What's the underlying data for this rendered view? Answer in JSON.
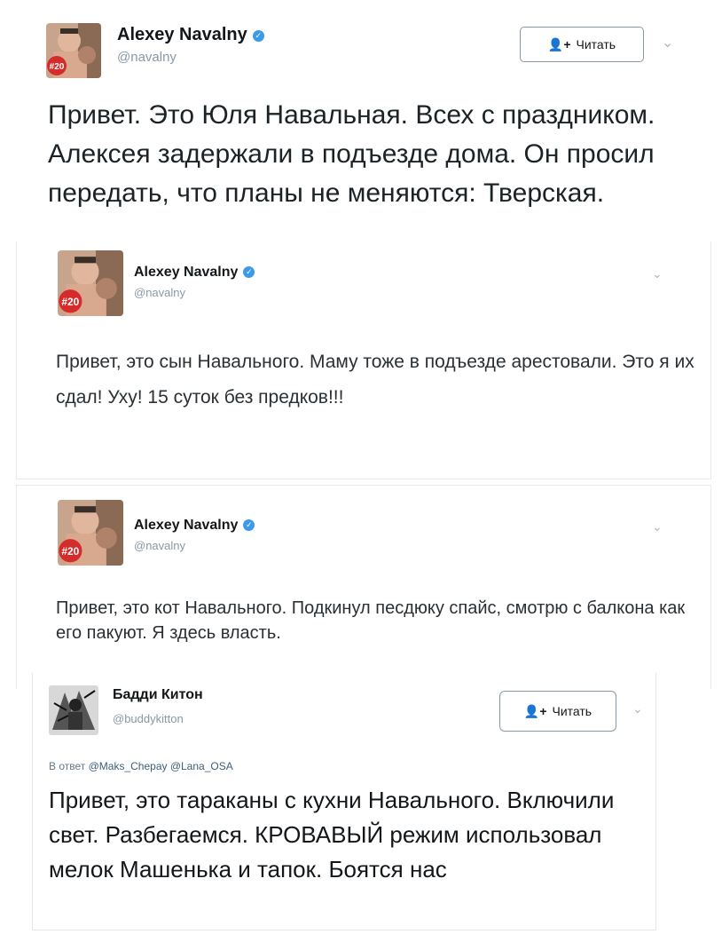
{
  "tweets": [
    {
      "name": "Alexey Navalny",
      "handle": "@navalny",
      "badge": "#20",
      "follow_label": "Читать",
      "text": "Привет. Это Юля Навальная. Всех с праздником. Алексея задержали в подъезде дома. Он просил передать, что планы не меняются: Тверская."
    },
    {
      "name": "Alexey Navalny",
      "handle": "@navalny",
      "badge": "#20",
      "text": "Привет, это сын Навального. Маму тоже в подъезде арестовали. Это я их сдал! Уху! 15 суток без предков!!!"
    },
    {
      "name": "Alexey Navalny",
      "handle": "@navalny",
      "badge": "#20",
      "text": "Привет, это кот Навального. Подкинул песдюку спайс, смотрю с балкона как его пакуют. Я здесь власть."
    },
    {
      "name": "Бадди Китон",
      "handle": "@buddykitton",
      "follow_label": "Читать",
      "reply_prefix": "В ответ",
      "reply_to": "@Maks_Chepay @Lana_OSA",
      "text": "Привет, это тараканы с кухни Навального. Включили свет. Разбегаемся. КРОВАВЫЙ режим использовал мелок Машенька и тапок. Боятся нас"
    }
  ],
  "colors": {
    "verified": "#3d9ae8",
    "handle": "#8899a6",
    "badge_red": "#d62b2b"
  }
}
